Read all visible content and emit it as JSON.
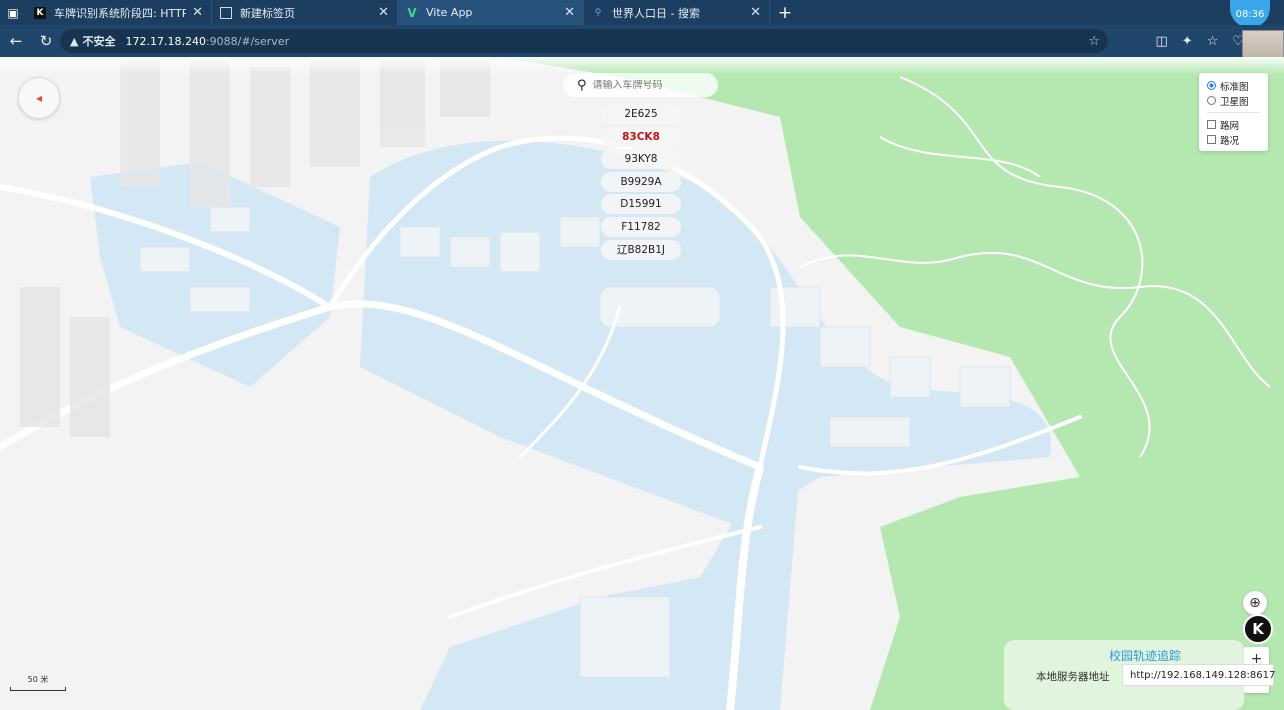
{
  "browser": {
    "tabs": [
      {
        "title": "车牌识别系统阶段四: HTTP服务",
        "favicon": "K",
        "active": false
      },
      {
        "title": "新建标签页",
        "favicon": "page",
        "active": false
      },
      {
        "title": "Vite App",
        "favicon": "V",
        "active": true
      },
      {
        "title": "世界人口日 - 搜索",
        "favicon": "search",
        "active": false
      }
    ],
    "clock": "08:36",
    "security_label": "不安全",
    "url_host": "172.17.18.240",
    "url_path": ":9088/#/server"
  },
  "map": {
    "search": {
      "placeholder": "请输入车牌号码"
    },
    "plates": [
      {
        "text": "2E625",
        "highlighted": false
      },
      {
        "text": "83CK8",
        "highlighted": true
      },
      {
        "text": "93KY8",
        "highlighted": false
      },
      {
        "text": "B9929A",
        "highlighted": false
      },
      {
        "text": "D15991",
        "highlighted": false
      },
      {
        "text": "F11782",
        "highlighted": false
      },
      {
        "text": "辽B82B1J",
        "highlighted": false
      }
    ],
    "layers": {
      "standard": "标准图",
      "satellite": "卫星图",
      "roadnet": "路网",
      "traffic": "路况"
    },
    "scale_label": "50 米",
    "zoom_in": "+",
    "zoom_out": "−"
  },
  "panel": {
    "title": "校园轨迹追踪",
    "server_label": "本地服务器地址",
    "server_value": "http://192.168.149.128:8617"
  },
  "colors": {
    "tabbar": "#1c3f61",
    "green_area": "#b4e8b0",
    "campus_blue": "#d4e7f5",
    "highlight_red": "#c0131a",
    "panel_title": "#2e98d9"
  }
}
